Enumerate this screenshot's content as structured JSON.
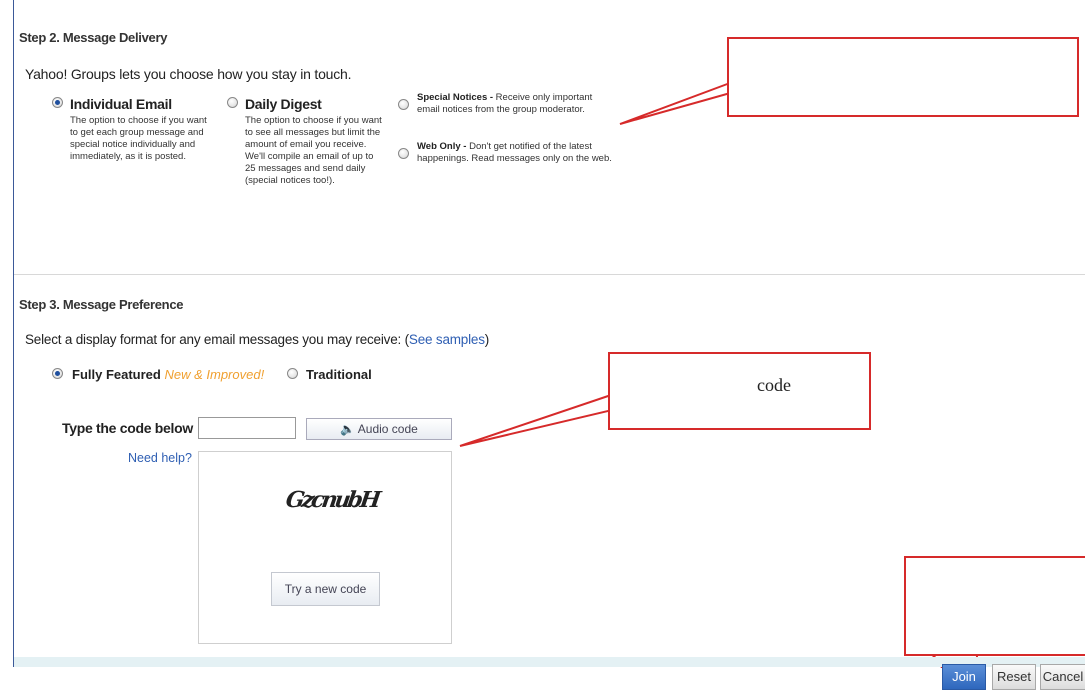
{
  "step2": {
    "heading": "Step 2. Message Delivery",
    "intro": "Yahoo! Groups lets you choose how you stay in touch.",
    "individual": {
      "title": "Individual Email",
      "desc": [
        "The option to choose if you want",
        "to get each group message and",
        "special notice individually and",
        "immediately, as it is posted."
      ],
      "selected": true
    },
    "digest": {
      "title": "Daily Digest",
      "desc": [
        "The option to choose if you want",
        "to see all messages but limit the",
        "amount of email you receive.",
        "We'll compile an email of up to",
        "25 messages and send daily",
        "(special notices too!)."
      ],
      "selected": false
    },
    "special": {
      "title": "Special Notices -",
      "desc1": " Receive only important",
      "desc2": "email notices from the group moderator.",
      "selected": false
    },
    "webonly": {
      "title": "Web Only -",
      "desc1": " Don't get notified of the latest",
      "desc2": "happenings. Read messages only on the web.",
      "selected": false
    }
  },
  "step3": {
    "heading": "Step 3. Message Preference",
    "intro_prefix": "Select a display format for any email messages you may receive: (",
    "see_samples": "See samples",
    "intro_suffix": ")",
    "fully_featured": "Fully Featured",
    "new_improved": "New & Improved!",
    "traditional": "Traditional",
    "format_selected": "fully_featured"
  },
  "captcha": {
    "label": "Type the code below",
    "input_value": "",
    "audio_label": "Audio code",
    "need_help": "Need help?",
    "code_image_text": "GzcnubH",
    "try_new": "Try a new code"
  },
  "callouts": {
    "top": "",
    "middle": "code",
    "bottom": ""
  },
  "footer": {
    "join": "Join",
    "reset": "Reset",
    "cancel": "Cancel"
  },
  "colors": {
    "callout_border": "#d62a2a",
    "link": "#2f5fb3",
    "footer_bg": "#e4f1f4",
    "join_bg": "#2e67bd"
  }
}
